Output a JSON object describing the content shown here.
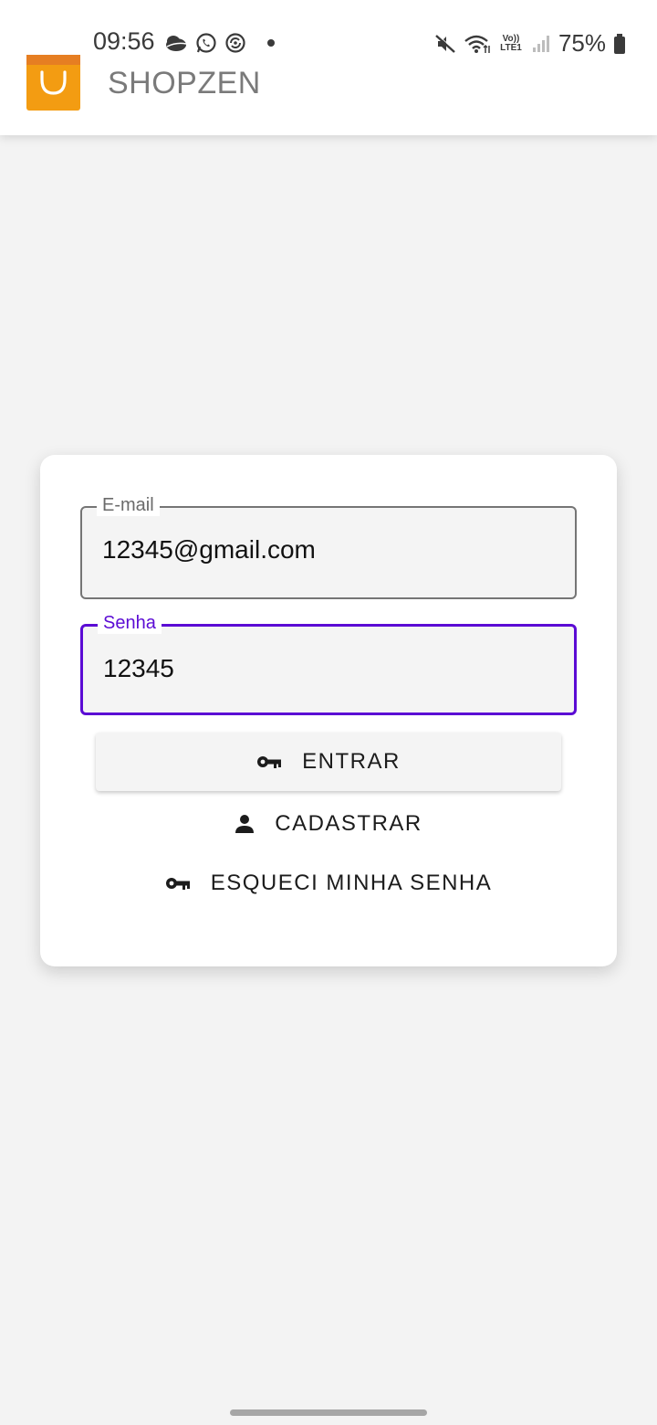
{
  "status_bar": {
    "time": "09:56",
    "battery_text": "75%",
    "network_label": "Vo)) LTE1",
    "left_icons": [
      "weather-icon",
      "whatsapp-icon",
      "sync-icon",
      "notification-dot-icon"
    ],
    "right_icons": [
      "mute-icon",
      "wifi-icon",
      "volte-lte-icon",
      "signal-icon",
      "battery-icon"
    ]
  },
  "app_bar": {
    "title": "SHOPZEN",
    "logo_icon": "shopping-bag-icon",
    "logo_color": "#f39c12"
  },
  "login_form": {
    "email": {
      "label": "E-mail",
      "value": "12345@gmail.com"
    },
    "password": {
      "label": "Senha",
      "value": "12345",
      "focused": true,
      "focus_color": "#5b0bd4"
    },
    "login_button": {
      "label": "ENTRAR",
      "icon": "key-icon"
    },
    "register_button": {
      "label": "CADASTRAR",
      "icon": "person-icon"
    },
    "forgot_button": {
      "label": "ESQUECI MINHA SENHA",
      "icon": "key-icon"
    }
  },
  "colors": {
    "background": "#f3f3f3",
    "accent": "#5b0bd4"
  }
}
